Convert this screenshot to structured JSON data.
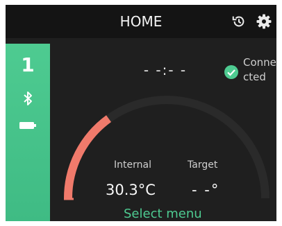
{
  "header": {
    "title": "HOME",
    "history_icon": "history-icon",
    "settings_icon": "gear-icon"
  },
  "sidebar": {
    "device_number": "1",
    "bluetooth_icon": "bluetooth-icon",
    "battery_icon": "battery-icon",
    "color": "#4ecb91"
  },
  "status": {
    "clock": "- -:- -",
    "connection": "Connected",
    "check_icon": "check-circle-icon"
  },
  "gauge": {
    "fill_fraction": 0.3,
    "fill_color": "#f07a6b",
    "track_color": "#2a2a2a"
  },
  "readings": {
    "internal_label": "Internal",
    "internal_value": "30.3°C",
    "target_label": "Target",
    "target_value": "- -°"
  },
  "footer": {
    "select_menu": "Select menu",
    "accent": "#4ecb91"
  }
}
